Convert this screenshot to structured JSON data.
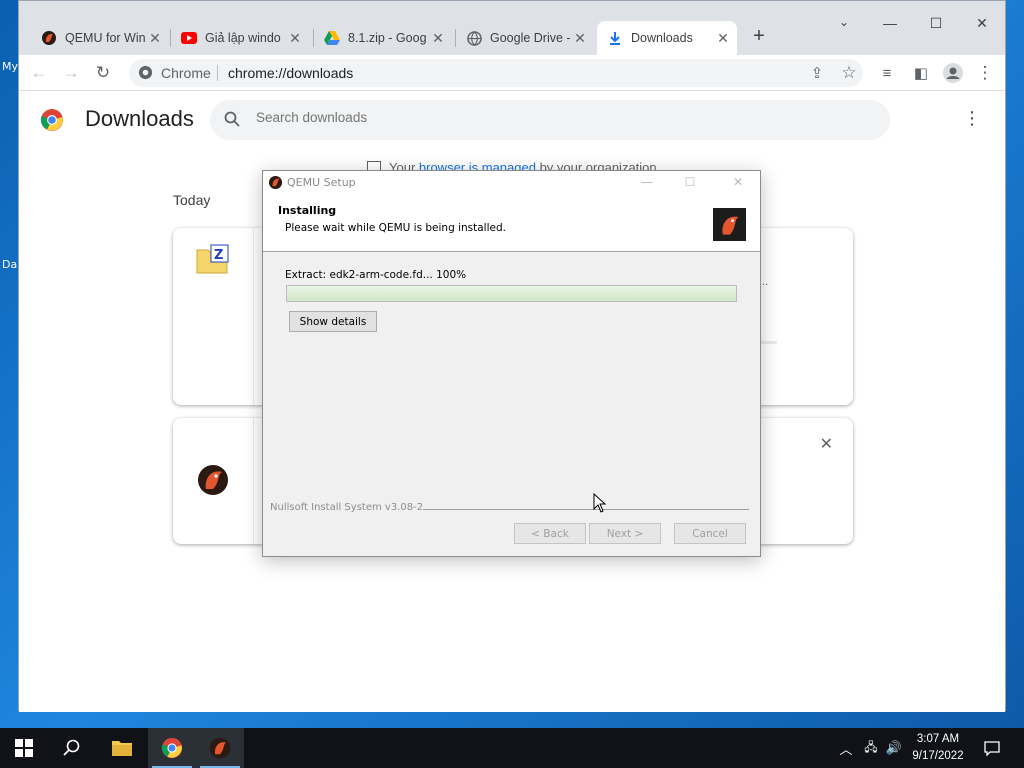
{
  "desktop": {
    "labels": [
      "My",
      "Da"
    ]
  },
  "browser": {
    "tabs": [
      {
        "title": "QEMU for Win",
        "icon": "qemu-icon"
      },
      {
        "title": "Giả lập windo",
        "icon": "youtube-icon"
      },
      {
        "title": "8.1.zip - Goog",
        "icon": "google-drive-icon"
      },
      {
        "title": "Google Drive -",
        "icon": "globe-icon"
      },
      {
        "title": "Downloads",
        "icon": "download-icon",
        "active": true
      }
    ],
    "omnibox": {
      "chip": "Chrome",
      "url": "chrome://downloads"
    }
  },
  "downloads_page": {
    "title": "Downloads",
    "search_placeholder": "Search downloads",
    "managed_notice": {
      "prefix": "Your ",
      "link": "browser is managed",
      "suffix": " by your organization"
    },
    "section_label": "Today",
    "items": [
      {
        "icon": "zip-folder-icon",
        "truncated_hint": "..."
      },
      {
        "icon": "qemu-icon"
      }
    ]
  },
  "installer": {
    "window_title": "QEMU Setup",
    "heading": "Installing",
    "subheading": "Please wait while QEMU is being installed.",
    "status": "Extract: edk2-arm-code.fd... 100%",
    "progress": 1.0,
    "show_details_label": "Show details",
    "branding": "Nullsoft Install System v3.08-2",
    "back_label": "< Back",
    "next_label": "Next >",
    "cancel_label": "Cancel"
  },
  "taskbar": {
    "time": "3:07 AM",
    "date": "9/17/2022"
  },
  "colors": {
    "accent": "#1a73e8",
    "taskbar": "#101217",
    "progress": "#cfe8c8"
  }
}
